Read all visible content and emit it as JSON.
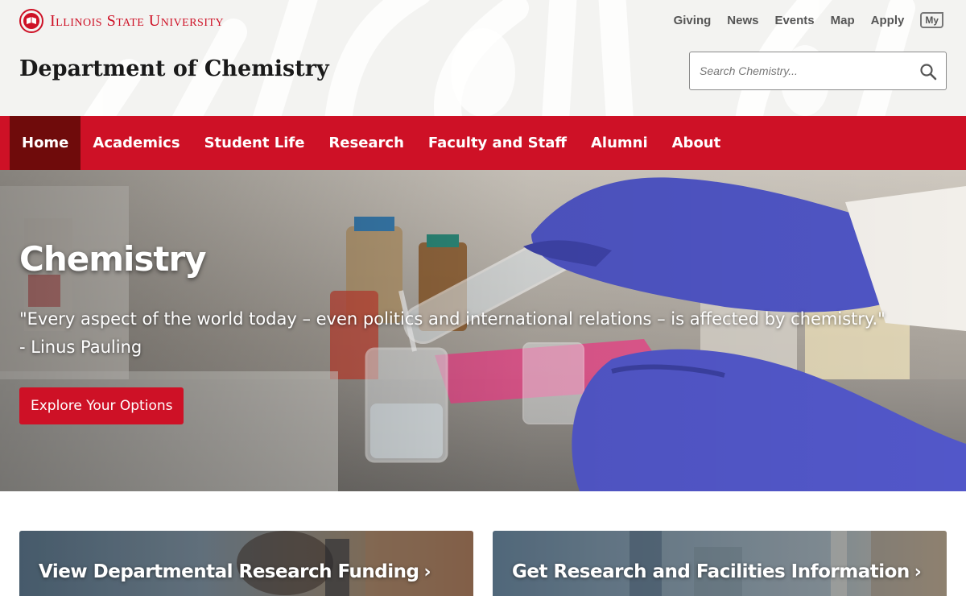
{
  "header": {
    "wordmark": "Illinois State University",
    "department_title": "Department of Chemistry",
    "utility_links": [
      "Giving",
      "News",
      "Events",
      "Map",
      "Apply"
    ],
    "my_badge": "My",
    "search": {
      "placeholder": "Search Chemistry..."
    }
  },
  "nav": {
    "items": [
      "Home",
      "Academics",
      "Student Life",
      "Research",
      "Faculty and Staff",
      "Alumni",
      "About"
    ],
    "active": "Home"
  },
  "hero": {
    "title": "Chemistry",
    "quote_line1": "\"Every aspect of the world today – even politics and international relations – is affected by chemistry.\"",
    "quote_line2": "- Linus Pauling",
    "cta_label": "Explore Your Options"
  },
  "cards": [
    {
      "title": "View Departmental Research Funding",
      "chevron": "›"
    },
    {
      "title": "Get Research and Facilities Information",
      "chevron": "›"
    }
  ],
  "colors": {
    "brand_red": "#ce1126",
    "nav_active": "#6f0b0b",
    "header_bg": "#f3f3f1",
    "glove_purple": "#4f55c4"
  },
  "icons": [
    "university-seal-icon",
    "my-badge-icon",
    "search-icon",
    "chevron-right-icon"
  ]
}
